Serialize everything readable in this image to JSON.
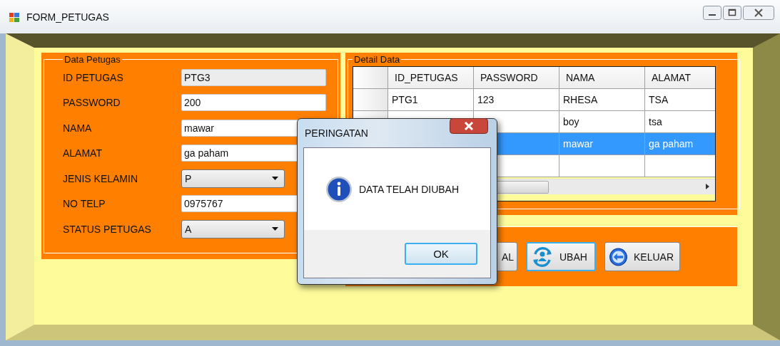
{
  "window": {
    "title": "FORM_PETUGAS"
  },
  "data_petugas": {
    "title": "Data Petugas",
    "fields": [
      {
        "label": "ID PETUGAS",
        "kind": "text",
        "value": "PTG3",
        "disabled": true
      },
      {
        "label": "PASSWORD",
        "kind": "text",
        "value": "200",
        "disabled": false
      },
      {
        "label": "NAMA",
        "kind": "text",
        "value": "mawar",
        "disabled": false
      },
      {
        "label": "ALAMAT",
        "kind": "text",
        "value": "ga paham",
        "disabled": false
      },
      {
        "label": "JENIS KELAMIN",
        "kind": "combo",
        "value": "P",
        "disabled": false
      },
      {
        "label": "NO TELP",
        "kind": "text",
        "value": "0975767",
        "disabled": false
      },
      {
        "label": "STATUS PETUGAS",
        "kind": "combo",
        "value": "A",
        "disabled": false
      }
    ]
  },
  "detail_data": {
    "title": "Detail Data",
    "table": {
      "columns": [
        "ID_PETUGAS",
        "PASSWORD",
        "NAMA",
        "ALAMAT"
      ],
      "rows": [
        {
          "id_petugas": "PTG1",
          "password": "123",
          "nama": "RHESA",
          "alamat": "TSA",
          "selected": false
        },
        {
          "nama": "boy",
          "alamat": "tsa",
          "selected": false
        },
        {
          "nama": "mawar",
          "alamat": "ga paham",
          "selected": true
        },
        {
          "selected": false
        }
      ]
    }
  },
  "buttons": [
    {
      "label": "AL",
      "kind": "plain",
      "focused": false
    },
    {
      "label": "UBAH",
      "kind": "update",
      "focused": true
    },
    {
      "label": "KELUAR",
      "kind": "exit",
      "focused": false
    }
  ],
  "dialog": {
    "title": "PERINGATAN",
    "message": "DATA TELAH DIUBAH",
    "button": "OK"
  }
}
